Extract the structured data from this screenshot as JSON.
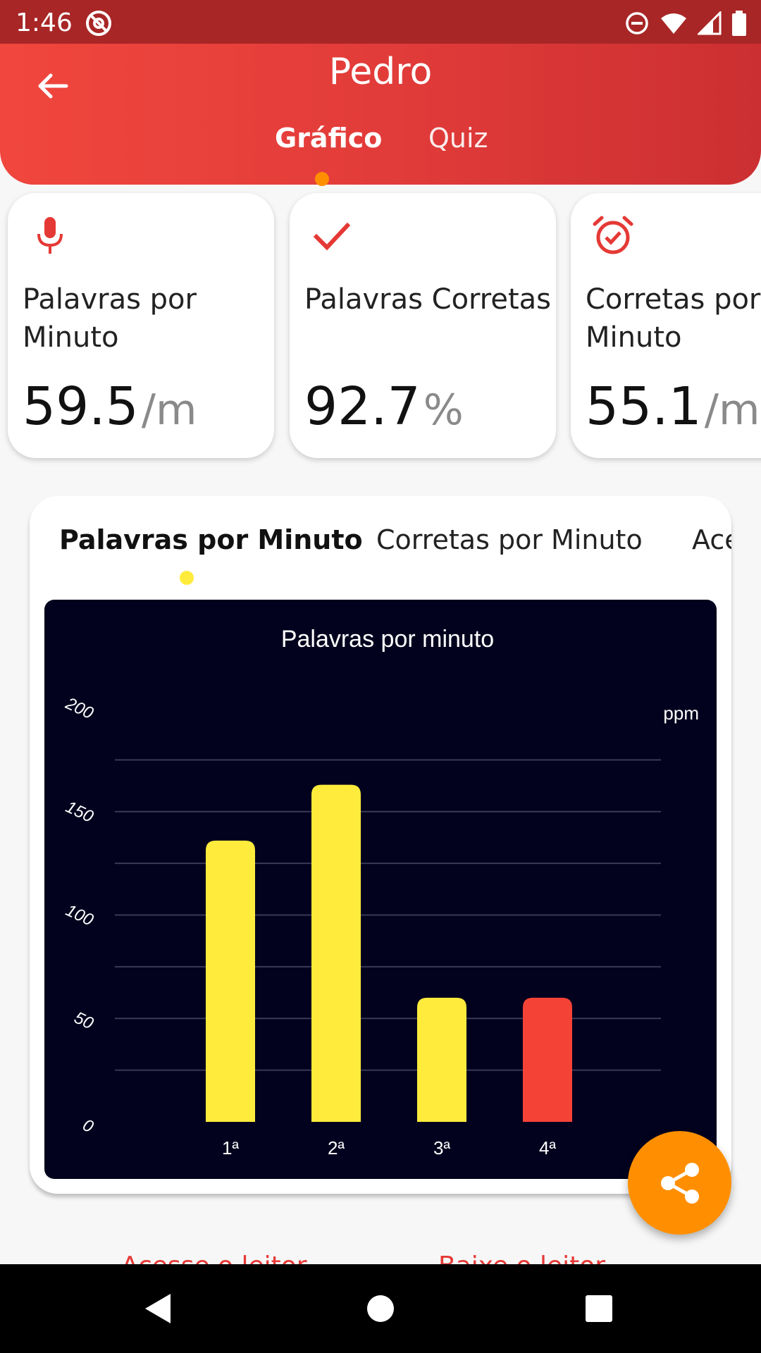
{
  "status_bar": {
    "time": "1:46"
  },
  "header": {
    "title": "Pedro",
    "tabs": [
      {
        "label": "Gráfico",
        "selected": true
      },
      {
        "label": "Quiz",
        "selected": false
      }
    ],
    "indicator_color": "#ff8f00"
  },
  "stats": [
    {
      "icon": "microphone-icon",
      "label": "Palavras por Minuto",
      "value": "59.5",
      "unit": "/m"
    },
    {
      "icon": "check-icon",
      "label": "Palavras Corretas",
      "value": "92.7",
      "unit": "%"
    },
    {
      "icon": "alarm-check-icon",
      "label": "Corretas por Minuto",
      "value": "55.1",
      "unit": "/m"
    }
  ],
  "chart_tabs": [
    {
      "label": "Palavras por Minuto",
      "selected": true
    },
    {
      "label": "Corretas por Minuto",
      "selected": false
    },
    {
      "label": "Ace",
      "selected": false
    }
  ],
  "chart_data": {
    "type": "bar",
    "title": "Palavras por minuto",
    "unit_label": "ppm",
    "categories": [
      "1ª",
      "2ª",
      "3ª",
      "4ª"
    ],
    "values": [
      136,
      163,
      60,
      60
    ],
    "bar_colors": [
      "#ffeb3b",
      "#ffeb3b",
      "#ffeb3b",
      "#f44336"
    ],
    "ylim": [
      0,
      200
    ],
    "y_ticks": [
      0,
      50,
      100,
      150,
      200
    ],
    "grid": true,
    "background": "#03021e"
  },
  "fab": {
    "icon": "share-icon",
    "color": "#ff8f00"
  },
  "footer": {
    "link_1": "Acesse o leitor",
    "link_2": "Baixe o leitor"
  },
  "colors": {
    "primary": "#e53935",
    "status_bar": "#a82626"
  }
}
